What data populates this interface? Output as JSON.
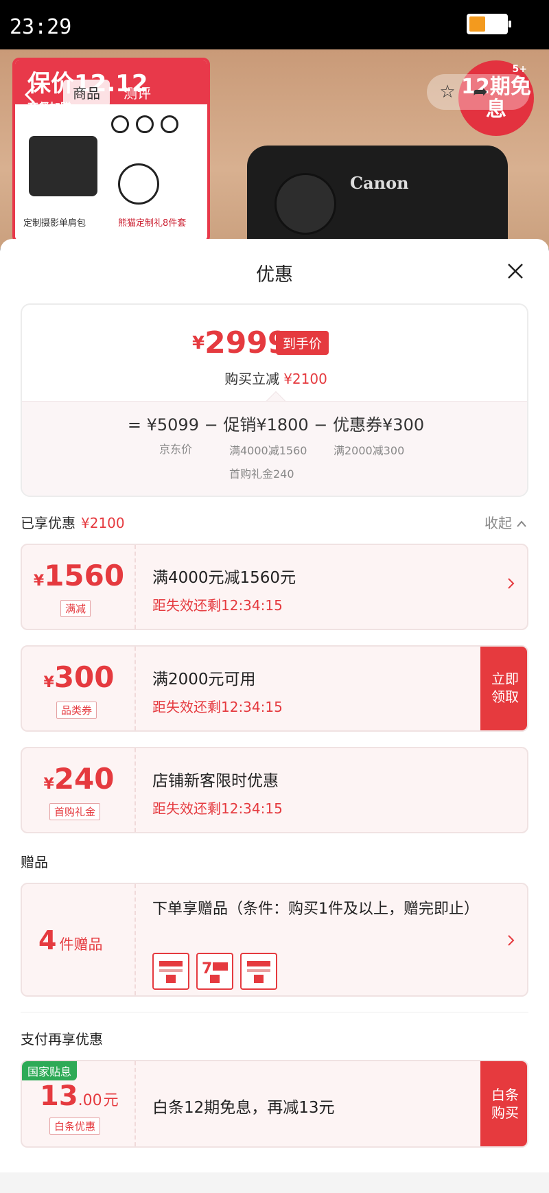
{
  "status_bar": {
    "time": "23:29",
    "battery_level_percent": 45
  },
  "product_backdrop": {
    "banner_text": "保价12.12",
    "banner_sub": "套餐加赠",
    "bag_label": "定制摄影单肩包",
    "gift_label": "熊猫定制礼8件套",
    "camera_brand": "Canon",
    "badge_text": "12期免息",
    "badge_sup": "5+",
    "tabs": [
      {
        "label": "商品",
        "active": true
      },
      {
        "label": "测评",
        "active": false
      }
    ]
  },
  "sheet": {
    "title": "优惠",
    "summary": {
      "final_currency": "¥",
      "final_price": "2999",
      "final_tag": "到手价",
      "buy_off_label": "购买立减",
      "buy_off_amount": "¥2100",
      "formula": "= ¥5099 − 促销¥1800 − 优惠券¥300",
      "notes": {
        "jd_price": "京东价",
        "promo_1": "满4000减1560",
        "promo_2": "首购礼金240",
        "coupon": "满2000减300"
      }
    },
    "enjoyed": {
      "label": "已享优惠",
      "amount": "¥2100",
      "collapse_label": "收起"
    },
    "coupons": [
      {
        "currency": "¥",
        "amount": "1560",
        "chip": "满减",
        "line1": "满4000元减1560元",
        "line2": "距失效还剩12:34:15",
        "action": "arrow"
      },
      {
        "currency": "¥",
        "amount": "300",
        "chip": "品类券",
        "line1": "满2000元可用",
        "line2": "距失效还剩12:34:15",
        "action": "claim",
        "claim_label_1": "立即",
        "claim_label_2": "领取"
      },
      {
        "currency": "¥",
        "amount": "240",
        "chip": "首购礼金",
        "line1": "店铺新客限时优惠",
        "line2": "距失效还剩12:34:15",
        "action": "none"
      }
    ],
    "gifts": {
      "section_label": "赠品",
      "count": "4",
      "unit": "件赠品",
      "desc": "下单享赠品（条件：购买1件及以上，赠完即止）",
      "icons": [
        "invoice-icon",
        "seven-day-return-icon",
        "invoice-icon"
      ]
    },
    "payment": {
      "section_label": "支付再享优惠",
      "gov_tag": "国家贴息",
      "amount_int": "13",
      "amount_dec": ".00",
      "unit": "元",
      "chip": "白条优惠",
      "desc": "白条12期免息，再减13元",
      "btn_1": "白条",
      "btn_2": "购买"
    }
  },
  "colors": {
    "accent_red": "#e53a3f",
    "gov_green": "#2eaa56"
  }
}
